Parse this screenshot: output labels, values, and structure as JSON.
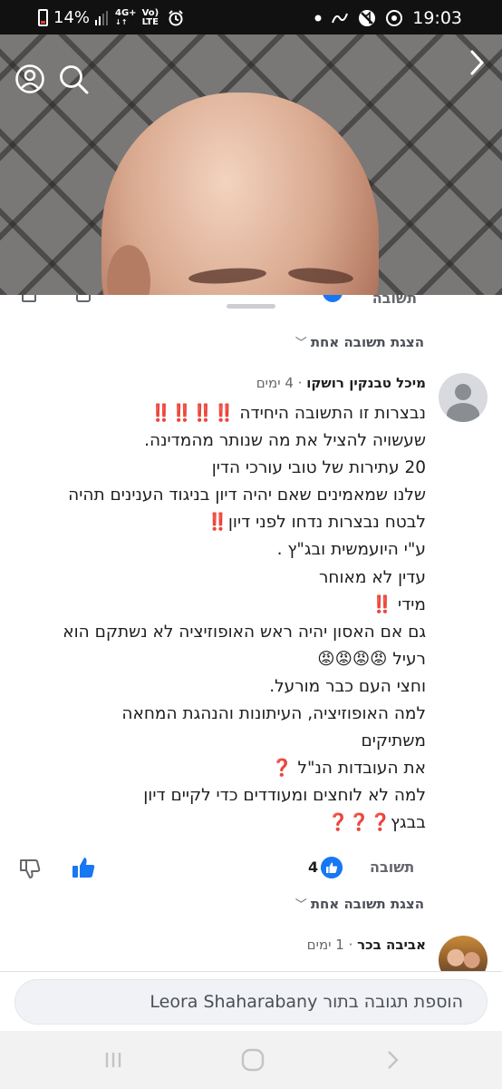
{
  "status_bar": {
    "battery": "14%",
    "network": "4G+",
    "volte": "Vo) LTE",
    "time": "19:03",
    "battery_color": "#e53935"
  },
  "video": {
    "icons": [
      "profile-icon",
      "search-icon",
      "chevron-right-icon"
    ]
  },
  "prev_comment": {
    "reply_label": "תשובה",
    "view_replies": "הצגת תשובה אחת"
  },
  "comment": {
    "author": "מיכל טבנקין רושקו",
    "separator": "·",
    "time": "4 ימים",
    "lines": [
      "נבצרות זו התשובה היחידה ‼️‼️‼️‼️",
      "שעשויה להציל את מה שנותר מהמדינה.",
      "20 עתירות של טובי עורכי הדין",
      "שלנו שמאמינים שאם יהיה דיון בניגוד הענינים תהיה",
      "לבטח נבצרות נדחו לפני דיון‼️",
      "ע\"י היועמשית ובג\"ץ .",
      "עדין לא מאוחר",
      "מידי ‼️",
      "גם אם האסון יהיה ראש האופוזיציה לא נשתקם הוא",
      "רעיל 😡😡😡😡",
      "וחצי העם כבר מורעל.",
      "למה האופוזיציה, העיתונות והנהגת המחאה",
      "משתיקים",
      "את העובדות הנ\"ל ❓",
      "למה לא לוחצים ומעודדים כדי לקיים דיון",
      "בבגץ❓❓❓"
    ],
    "reply_label": "תשובה",
    "like_count": "4",
    "view_replies": "הצגת תשובה אחת",
    "accent": "#1877f2"
  },
  "next_comment": {
    "author": "אביבה בכר",
    "separator": "·",
    "time": "1 ימים"
  },
  "input": {
    "placeholder": "הוספת תגובה בתור Leora Shaharabany"
  },
  "nav": {
    "icons": [
      "recent-apps-icon",
      "home-icon",
      "back-icon"
    ]
  }
}
